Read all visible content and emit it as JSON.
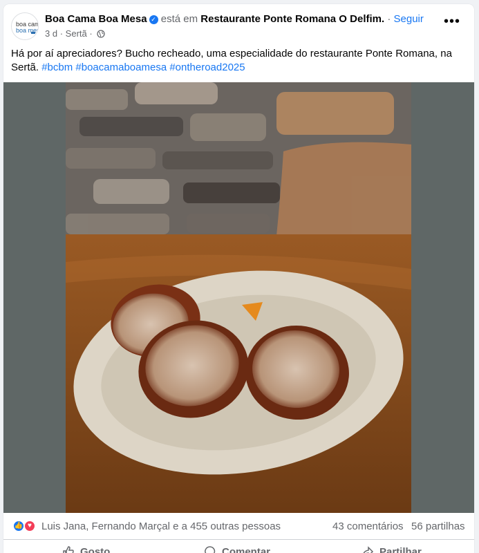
{
  "post": {
    "page_name": "Boa Cama Boa Mesa",
    "verified_icon": "verified-badge-icon",
    "at_text": "está em",
    "location": "Restaurante Ponte Romana O Delfim.",
    "separator": "·",
    "follow_label": "Seguir",
    "time": "3 d",
    "place": "Sertã",
    "dot": "·",
    "privacy_icon": "globe-icon",
    "body_text": "Há por aí apreciadores? Bucho recheado, uma especialidade do restaurante Ponte Romana, na Sertã.",
    "hashtags": [
      "#bcbm",
      "#boacamaboamesa",
      "#ontheroad2025"
    ],
    "avatar_lines": [
      "boa cama",
      "boa mesa"
    ]
  },
  "stats": {
    "reactions": [
      "like",
      "love"
    ],
    "reaction_summary": "Luis Jana, Fernando Marçal e a 455 outras pessoas",
    "comments": "43 comentários",
    "shares": "56 partilhas"
  },
  "actions": {
    "like": "Gosto",
    "comment": "Comentar",
    "share": "Partilhar"
  },
  "colors": {
    "link": "#1877f2",
    "muted": "#65676b",
    "love": "#f33e58"
  }
}
